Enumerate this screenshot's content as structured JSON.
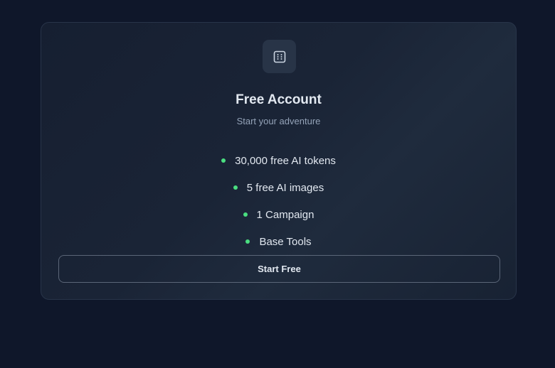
{
  "plan": {
    "icon": "dice-icon",
    "title": "Free Account",
    "subtitle": "Start your adventure",
    "features": [
      {
        "label": "30,000 free AI tokens"
      },
      {
        "label": "5 free AI images"
      },
      {
        "label": "1 Campaign"
      },
      {
        "label": "Base Tools"
      }
    ],
    "cta_label": "Start Free"
  },
  "colors": {
    "background": "#0f172a",
    "card": "#1a2436",
    "bullet": "#4ade80",
    "text": "#e2e8f0",
    "muted": "#94a3b8"
  }
}
